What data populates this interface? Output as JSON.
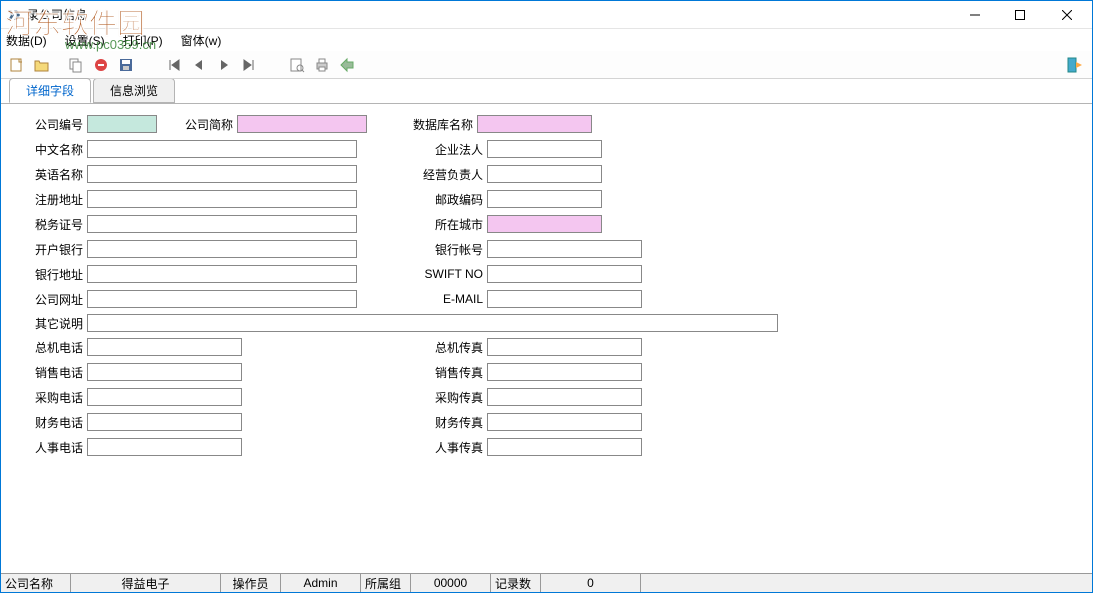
{
  "window": {
    "title": "录公司信息"
  },
  "watermark": {
    "top": "河东软件园",
    "url": "www.pc0359.cn"
  },
  "menu": {
    "data": "数据(D)",
    "settings": "设置(S)",
    "print": "打印(P)",
    "window": "窗体(w)"
  },
  "tabs": {
    "detail": "详细字段",
    "browse": "信息浏览"
  },
  "labels": {
    "company_no": "公司编号",
    "company_short": "公司简称",
    "db_name": "数据库名称",
    "cn_name": "中文名称",
    "legal_person": "企业法人",
    "en_name": "英语名称",
    "manager": "经营负责人",
    "reg_addr": "注册地址",
    "postcode": "邮政编码",
    "tax_no": "税务证号",
    "city": "所在城市",
    "bank": "开户银行",
    "bank_account": "银行帐号",
    "bank_addr": "银行地址",
    "swift": "SWIFT NO",
    "website": "公司网址",
    "email": "E-MAIL",
    "other": "其它说明",
    "main_tel": "总机电话",
    "main_fax": "总机传真",
    "sales_tel": "销售电话",
    "sales_fax": "销售传真",
    "purchase_tel": "采购电话",
    "purchase_fax": "采购传真",
    "finance_tel": "财务电话",
    "finance_fax": "财务传真",
    "hr_tel": "人事电话",
    "hr_fax": "人事传真"
  },
  "values": {
    "company_no": "",
    "company_short": "",
    "db_name": "",
    "cn_name": "",
    "legal_person": "",
    "en_name": "",
    "manager": "",
    "reg_addr": "",
    "postcode": "",
    "tax_no": "",
    "city": "",
    "bank": "",
    "bank_account": "",
    "bank_addr": "",
    "swift": "",
    "website": "",
    "email": "",
    "other": "",
    "main_tel": "",
    "main_fax": "",
    "sales_tel": "",
    "sales_fax": "",
    "purchase_tel": "",
    "purchase_fax": "",
    "finance_tel": "",
    "finance_fax": "",
    "hr_tel": "",
    "hr_fax": ""
  },
  "status": {
    "company_name_label": "公司名称",
    "company_name_value": "得益电子",
    "operator_label": "操作员",
    "operator_value": "Admin",
    "group_label": "所属组",
    "group_value": "00000",
    "record_label": "记录数",
    "record_value": "0"
  }
}
